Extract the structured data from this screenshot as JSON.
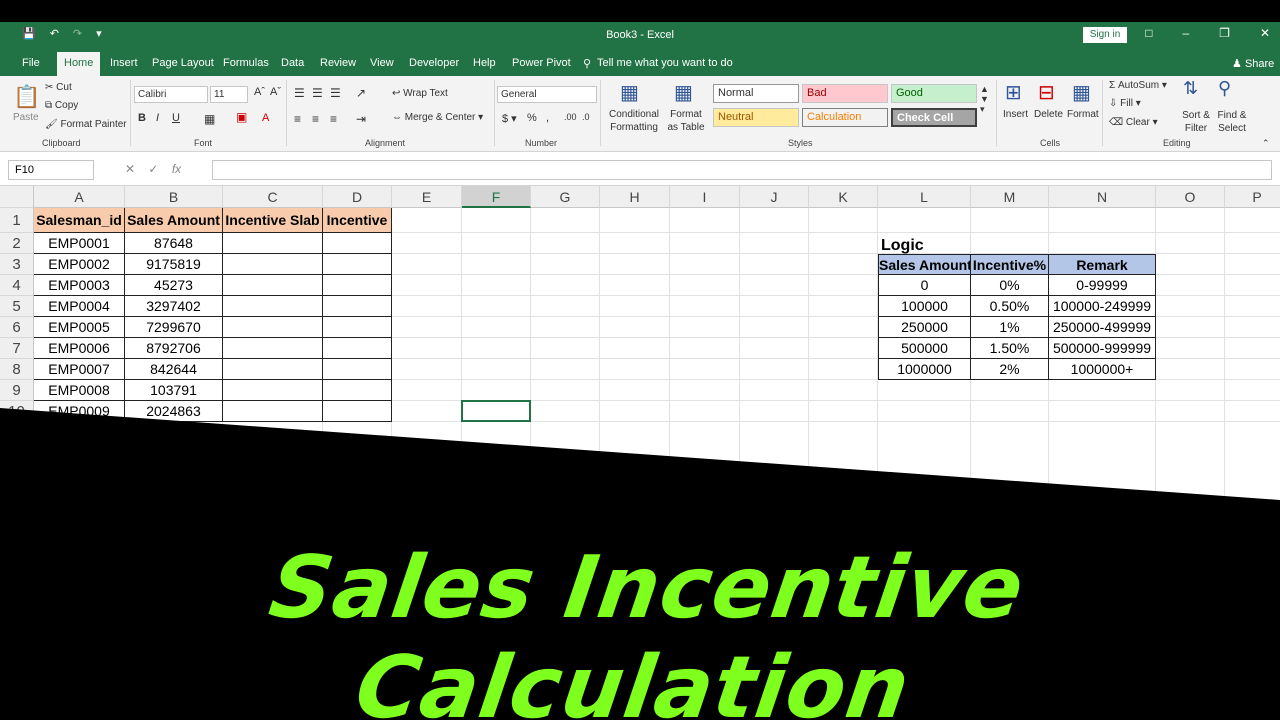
{
  "window": {
    "title": "Book3  -  Excel",
    "sign_in": "Sign in"
  },
  "tabs": [
    "File",
    "Home",
    "Insert",
    "Page Layout",
    "Formulas",
    "Data",
    "Review",
    "View",
    "Developer",
    "Help",
    "Power Pivot"
  ],
  "tell_me": "Tell me what you want to do",
  "share": "Share",
  "ribbon": {
    "clipboard": {
      "paste": "Paste",
      "cut": "Cut",
      "copy": "Copy",
      "format_painter": "Format Painter",
      "label": "Clipboard"
    },
    "font": {
      "name": "Calibri",
      "size": "11",
      "label": "Font"
    },
    "alignment": {
      "wrap": "Wrap Text",
      "merge": "Merge & Center",
      "label": "Alignment"
    },
    "number": {
      "format": "General",
      "label": "Number"
    },
    "styles": {
      "conditional": "Conditional Formatting",
      "format_table": "Format as Table",
      "normal": "Normal",
      "bad": "Bad",
      "good": "Good",
      "neutral": "Neutral",
      "calculation": "Calculation",
      "check_cell": "Check Cell",
      "label": "Styles"
    },
    "cells": {
      "insert": "Insert",
      "delete": "Delete",
      "format": "Format",
      "label": "Cells"
    },
    "editing": {
      "autosum": "AutoSum",
      "fill": "Fill",
      "clear": "Clear",
      "sort": "Sort & Filter",
      "find": "Find & Select",
      "label": "Editing"
    }
  },
  "name_box": "F10",
  "columns": [
    "A",
    "B",
    "C",
    "D",
    "E",
    "F",
    "G",
    "H",
    "I",
    "J",
    "K",
    "L",
    "M",
    "N",
    "O",
    "P"
  ],
  "rows": [
    "1",
    "2",
    "3",
    "4",
    "5",
    "6",
    "7",
    "8",
    "9",
    "10"
  ],
  "table": {
    "headers": [
      "Salesman_id",
      "Sales Amount",
      "Incentive Slab",
      "Incentive"
    ],
    "rows": [
      [
        "EMP0001",
        "87648"
      ],
      [
        "EMP0002",
        "9175819"
      ],
      [
        "EMP0003",
        "45273"
      ],
      [
        "EMP0004",
        "3297402"
      ],
      [
        "EMP0005",
        "7299670"
      ],
      [
        "EMP0006",
        "8792706"
      ],
      [
        "EMP0007",
        "842644"
      ],
      [
        "EMP0008",
        "103791"
      ],
      [
        "EMP0009",
        "2024863"
      ]
    ]
  },
  "logic": {
    "title": "Logic",
    "headers": [
      "Sales Amount",
      "Incentive%",
      "Remark"
    ],
    "rows": [
      [
        "0",
        "0%",
        "0-99999"
      ],
      [
        "100000",
        "0.50%",
        "100000-249999"
      ],
      [
        "250000",
        "1%",
        "250000-499999"
      ],
      [
        "500000",
        "1.50%",
        "500000-999999"
      ],
      [
        "1000000",
        "2%",
        "1000000+"
      ]
    ]
  },
  "banner": "Sales Incentive Calculation",
  "colors": {
    "excel_green": "#217346",
    "header_fill": "#f8cbad",
    "logic_header_fill": "#b4c6e7",
    "banner_text": "#7fff1e"
  }
}
